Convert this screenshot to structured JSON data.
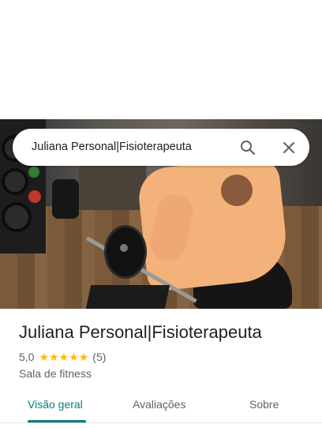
{
  "search": {
    "query": "Juliana Personal|Fisioterapeuta"
  },
  "place": {
    "name": "Juliana Personal|Fisioterapeuta",
    "rating": "5,0",
    "stars": 5,
    "review_count": "(5)",
    "category": "Sala de fitness"
  },
  "tabs": [
    {
      "label": "Visão geral",
      "active": true
    },
    {
      "label": "Avaliações",
      "active": false
    },
    {
      "label": "Sobre",
      "active": false
    }
  ],
  "icons": {
    "search": "search-icon",
    "close": "close-icon",
    "star": "star-icon"
  },
  "colors": {
    "accent": "#0b7a7a",
    "star": "#fbbc04"
  }
}
